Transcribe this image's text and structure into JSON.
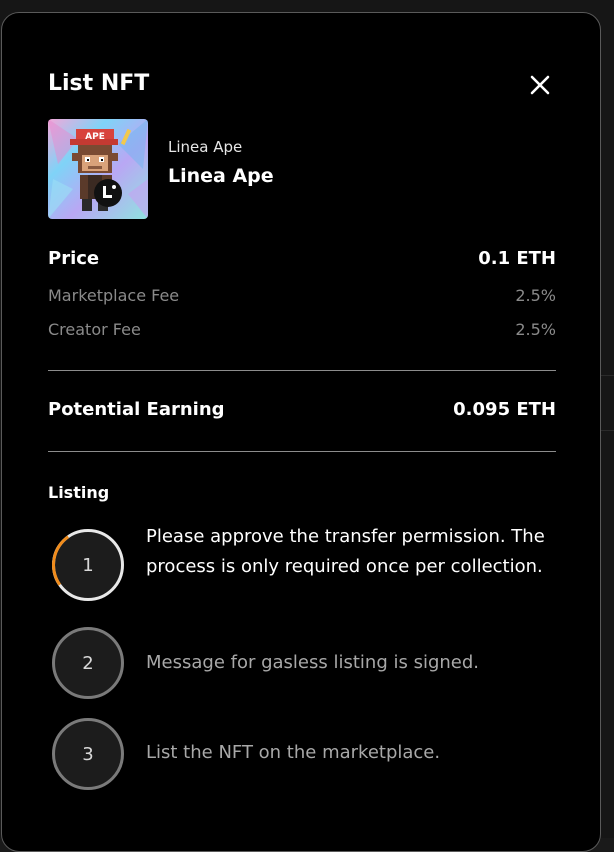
{
  "modal": {
    "title": "List NFT"
  },
  "nft": {
    "collection": "Linea Ape",
    "name": "Linea Ape",
    "badge_text": "APE"
  },
  "pricing": {
    "price_label": "Price",
    "price_value": "0.1 ETH",
    "marketplace_fee_label": "Marketplace Fee",
    "marketplace_fee_value": "2.5%",
    "creator_fee_label": "Creator Fee",
    "creator_fee_value": "2.5%",
    "earning_label": "Potential Earning",
    "earning_value": "0.095 ETH"
  },
  "listing": {
    "label": "Listing",
    "steps": [
      {
        "number": "1",
        "text": "Please approve the transfer permission. The process is only required once per collection.",
        "state": "in-progress"
      },
      {
        "number": "2",
        "text": "Message for gasless listing is signed.",
        "state": "pending"
      },
      {
        "number": "3",
        "text": "List the NFT on the marketplace.",
        "state": "pending"
      }
    ]
  },
  "colors": {
    "background": "#000000",
    "accent": "#f08c1c",
    "muted_text": "#8a8a8a"
  },
  "icons": {
    "close": "close-icon"
  }
}
